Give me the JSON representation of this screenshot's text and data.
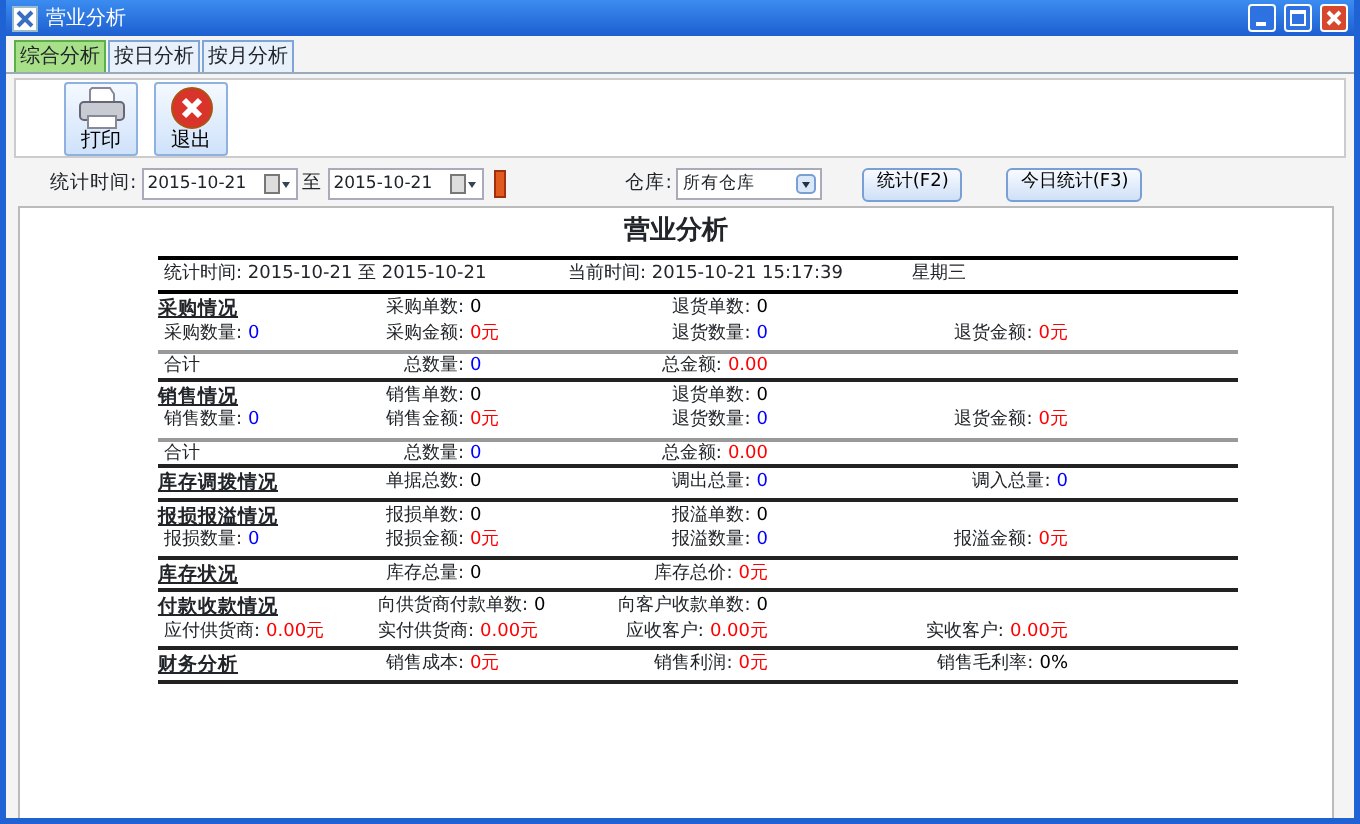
{
  "window": {
    "title": "营业分析"
  },
  "tabs": [
    {
      "label": "综合分析",
      "selected": true
    },
    {
      "label": "按日分析",
      "selected": false
    },
    {
      "label": "按月分析",
      "selected": false
    }
  ],
  "toolbar": [
    {
      "label": "打印",
      "kind": "print"
    },
    {
      "label": "退出",
      "kind": "exit"
    }
  ],
  "filter": {
    "range_label": "统计时间:",
    "date_from": "2015-10-21",
    "to_word": "至",
    "date_to": "2015-10-21",
    "warehouse_label": "仓库:",
    "warehouse": "所有仓库",
    "buttons": [
      "统计(F2)",
      "今日统计(F3)"
    ]
  },
  "report": {
    "title": "营业分析",
    "header": {
      "range_label": "统计时间:",
      "date_from": "2015-10-21",
      "to_word": "至",
      "date_to": "2015-10-21",
      "now_label": "当前时间:",
      "now_value": "2015-10-21 15:17:39",
      "weekday": "星期三"
    },
    "sections": [
      {
        "rows": [
          [
            {
              "kind": "heading",
              "text": "采购情况"
            },
            {
              "kind": "field",
              "label": "采购单数:",
              "value": "0",
              "color": "#000000"
            },
            {
              "kind": "field",
              "label": "退货单数:",
              "value": "0",
              "color": "#000000"
            }
          ],
          [
            {
              "kind": "field",
              "label": "采购数量:",
              "value": "0",
              "color": "#0000ff"
            },
            {
              "kind": "field",
              "label": "采购金额:",
              "value": "0元",
              "color": "#ff0000"
            },
            {
              "kind": "field",
              "label": "退货数量:",
              "value": "0",
              "color": "#0000ff"
            },
            {
              "kind": "field",
              "label": "退货金额:",
              "value": "0元",
              "color": "#ff0000"
            }
          ]
        ],
        "total": [
          {
            "kind": "text",
            "text": "合计"
          },
          {
            "kind": "field",
            "label": "总数量:",
            "value": "0",
            "color": "#0000ff"
          },
          {
            "kind": "field",
            "label": "总金额:",
            "value": "0.00",
            "color": "#ff0000"
          }
        ]
      },
      {
        "rows": [
          [
            {
              "kind": "heading",
              "text": "销售情况"
            },
            {
              "kind": "field",
              "label": "销售单数:",
              "value": "0",
              "color": "#000000"
            },
            {
              "kind": "field",
              "label": "退货单数:",
              "value": "0",
              "color": "#000000"
            }
          ],
          [
            {
              "kind": "field",
              "label": "销售数量:",
              "value": "0",
              "color": "#0000ff"
            },
            {
              "kind": "field",
              "label": "销售金额:",
              "value": "0元",
              "color": "#ff0000"
            },
            {
              "kind": "field",
              "label": "退货数量:",
              "value": "0",
              "color": "#0000ff"
            },
            {
              "kind": "field",
              "label": "退货金额:",
              "value": "0元",
              "color": "#ff0000"
            }
          ]
        ],
        "total": [
          {
            "kind": "text",
            "text": "合计"
          },
          {
            "kind": "field",
            "label": "总数量:",
            "value": "0",
            "color": "#0000ff"
          },
          {
            "kind": "field",
            "label": "总金额:",
            "value": "0.00",
            "color": "#ff0000"
          }
        ]
      },
      {
        "rows": [
          [
            {
              "kind": "heading",
              "text": "库存调拨情况"
            },
            {
              "kind": "field",
              "label": "单据总数:",
              "value": "0",
              "color": "#000000"
            },
            {
              "kind": "field",
              "label": "调出总量:",
              "value": "0",
              "color": "#0000ff"
            },
            {
              "kind": "field",
              "label": "调入总量:",
              "value": "0",
              "color": "#0000ff"
            }
          ]
        ]
      },
      {
        "rows": [
          [
            {
              "kind": "heading",
              "text": "报损报溢情况"
            },
            {
              "kind": "field",
              "label": "报损单数:",
              "value": "0",
              "color": "#000000"
            },
            {
              "kind": "field",
              "label": "报溢单数:",
              "value": "0",
              "color": "#000000"
            }
          ],
          [
            {
              "kind": "field",
              "label": "报损数量:",
              "value": "0",
              "color": "#0000ff"
            },
            {
              "kind": "field",
              "label": "报损金额:",
              "value": "0元",
              "color": "#ff0000"
            },
            {
              "kind": "field",
              "label": "报溢数量:",
              "value": "0",
              "color": "#0000ff"
            },
            {
              "kind": "field",
              "label": "报溢金额:",
              "value": "0元",
              "color": "#ff0000"
            }
          ]
        ]
      },
      {
        "rows": [
          [
            {
              "kind": "heading",
              "text": "库存状况"
            },
            {
              "kind": "field",
              "label": "库存总量:",
              "value": "0",
              "color": "#000000"
            },
            {
              "kind": "field",
              "label": "库存总价:",
              "value": "0元",
              "color": "#ff0000"
            }
          ]
        ]
      },
      {
        "rows": [
          [
            {
              "kind": "heading",
              "text": "付款收款情况"
            },
            {
              "kind": "field",
              "label": "向供货商付款单数:",
              "value": "0",
              "color": "#000000"
            },
            {
              "kind": "field",
              "label": "向客户收款单数:",
              "value": "0",
              "color": "#000000"
            }
          ],
          [
            {
              "kind": "field",
              "label": "应付供货商:",
              "value": "0.00元",
              "color": "#ff0000"
            },
            {
              "kind": "field",
              "label": "实付供货商:",
              "value": "0.00元",
              "color": "#ff0000"
            },
            {
              "kind": "field",
              "label": "应收客户:",
              "value": "0.00元",
              "color": "#ff0000"
            },
            {
              "kind": "field",
              "label": "实收客户:",
              "value": "0.00元",
              "color": "#ff0000"
            }
          ]
        ]
      },
      {
        "rows": [
          [
            {
              "kind": "heading",
              "text": "财务分析"
            },
            {
              "kind": "field",
              "label": "销售成本:",
              "value": "0元",
              "color": "#ff0000"
            },
            {
              "kind": "field",
              "label": "销售利润:",
              "value": "0元",
              "color": "#ff0000"
            },
            {
              "kind": "field",
              "label": "销售毛利率:",
              "value": "0%",
              "color": "#000000"
            }
          ]
        ]
      }
    ]
  }
}
